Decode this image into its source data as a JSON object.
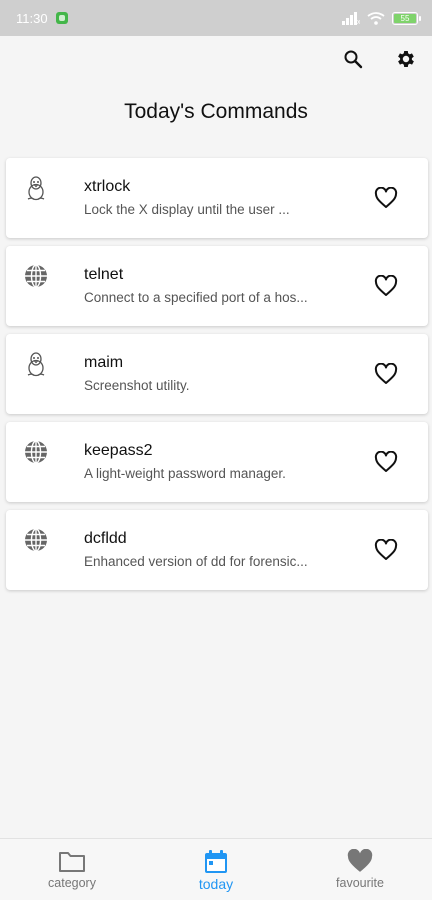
{
  "status_bar": {
    "time": "11:30",
    "battery": "55"
  },
  "header": {
    "title": "Today's Commands"
  },
  "commands": [
    {
      "name": "xtrlock",
      "description": "Lock the X display until the user ...",
      "icon": "linux-tux-icon"
    },
    {
      "name": "telnet",
      "description": "Connect to a specified port of a hos...",
      "icon": "globe-icon"
    },
    {
      "name": "maim",
      "description": "Screenshot utility.",
      "icon": "linux-tux-icon"
    },
    {
      "name": "keepass2",
      "description": "A light-weight password manager.",
      "icon": "globe-icon"
    },
    {
      "name": "dcfldd",
      "description": "Enhanced version of dd for forensic...",
      "icon": "globe-icon"
    }
  ],
  "bottom_nav": {
    "items": [
      {
        "label": "category",
        "icon": "folder-icon",
        "active": false
      },
      {
        "label": "today",
        "icon": "calendar-icon",
        "active": true
      },
      {
        "label": "favourite",
        "icon": "heart-filled-icon",
        "active": false
      }
    ]
  },
  "colors": {
    "accent": "#2196f3",
    "background": "#f5f5f5",
    "card": "#ffffff",
    "status_bar": "#cfcfcf"
  }
}
